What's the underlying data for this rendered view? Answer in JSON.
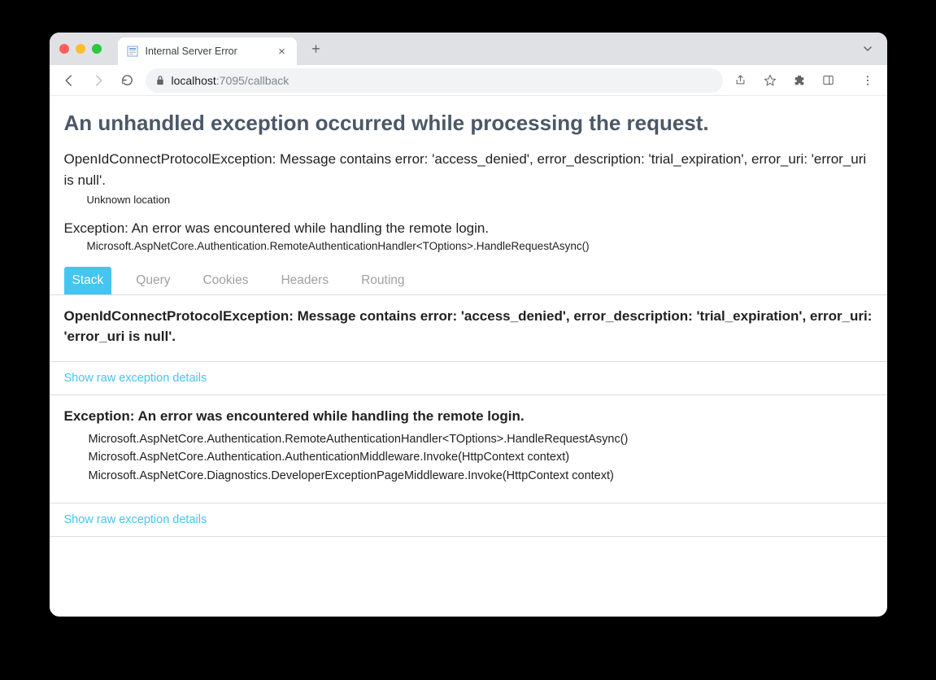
{
  "browser": {
    "tab_title": "Internal Server Error",
    "url_host": "localhost",
    "url_port_path": ":7095/callback"
  },
  "page": {
    "heading": "An unhandled exception occurred while processing the request.",
    "exception1": {
      "message": "OpenIdConnectProtocolException: Message contains error: 'access_denied', error_description: 'trial_expiration', error_uri: 'error_uri is null'.",
      "location": "Unknown location"
    },
    "exception2": {
      "message": "Exception: An error was encountered while handling the remote login.",
      "location": "Microsoft.AspNetCore.Authentication.RemoteAuthenticationHandler<TOptions>.HandleRequestAsync()"
    },
    "tabs": [
      "Stack",
      "Query",
      "Cookies",
      "Headers",
      "Routing"
    ],
    "active_tab": "Stack",
    "stack1": {
      "title": "OpenIdConnectProtocolException: Message contains error: 'access_denied', error_description: 'trial_expiration', error_uri: 'error_uri is null'.",
      "traces": []
    },
    "stack2": {
      "title": "Exception: An error was encountered while handling the remote login.",
      "traces": [
        "Microsoft.AspNetCore.Authentication.RemoteAuthenticationHandler<TOptions>.HandleRequestAsync()",
        "Microsoft.AspNetCore.Authentication.AuthenticationMiddleware.Invoke(HttpContext context)",
        "Microsoft.AspNetCore.Diagnostics.DeveloperExceptionPageMiddleware.Invoke(HttpContext context)"
      ]
    },
    "raw_link_label": "Show raw exception details"
  }
}
